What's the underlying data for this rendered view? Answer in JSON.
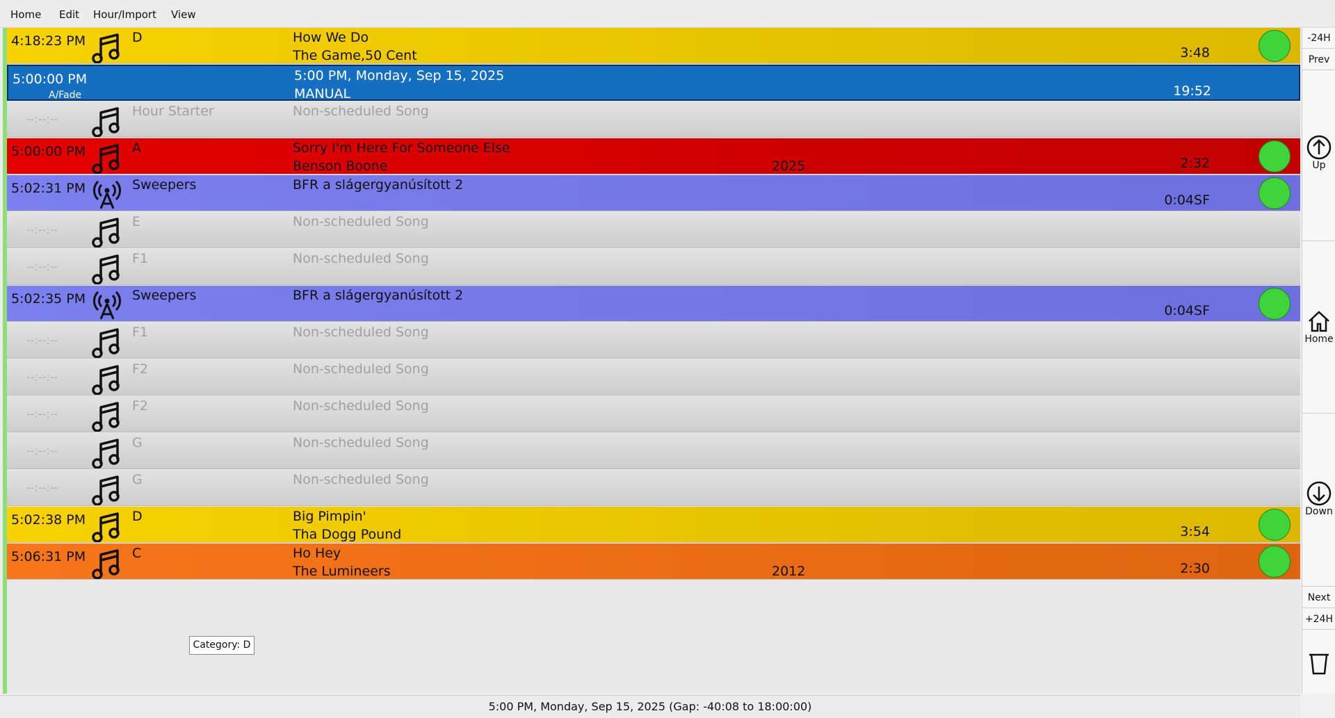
{
  "menu": {
    "home": "Home",
    "edit": "Edit",
    "hour_import": "Hour/Import",
    "view": "View"
  },
  "rows": [
    {
      "color": "yellow",
      "time": "4:18:23 PM",
      "icon": "music-note-icon",
      "cat": "D",
      "title": "How We Do",
      "artist": "The Game,50 Cent",
      "year": "",
      "dur": "3:48",
      "led": true
    },
    {
      "color": "blue",
      "time": "5:00:00 PM",
      "sub": "A/Fade",
      "icon": "",
      "cat": "",
      "title": "5:00 PM, Monday, Sep 15, 2025",
      "artist": "MANUAL",
      "year": "",
      "dur": "19:52",
      "led": false
    },
    {
      "color": "grey",
      "time": "--:--:--",
      "icon": "music-note-icon",
      "cat": "Hour Starter",
      "title": "Non-scheduled Song",
      "artist": "",
      "year": "",
      "dur": "",
      "led": false
    },
    {
      "color": "red",
      "time": "5:00:00 PM",
      "icon": "music-note-icon",
      "cat": "A",
      "title": "Sorry I'm Here For Someone Else",
      "artist": "Benson Boone",
      "year": "2025",
      "dur": "2:32",
      "led": true
    },
    {
      "color": "purple",
      "time": "5:02:31 PM",
      "icon": "antenna-icon",
      "cat": "Sweepers",
      "title": "BFR a slágergyanúsított 2",
      "artist": "",
      "year": "",
      "dur": "0:04SF",
      "led": true
    },
    {
      "color": "grey",
      "time": "--:--:--",
      "icon": "music-note-icon",
      "cat": "E",
      "title": "Non-scheduled Song",
      "artist": "",
      "year": "",
      "dur": "",
      "led": false
    },
    {
      "color": "grey",
      "time": "--:--:--",
      "icon": "music-note-icon",
      "cat": "F1",
      "title": "Non-scheduled Song",
      "artist": "",
      "year": "",
      "dur": "",
      "led": false
    },
    {
      "color": "purple",
      "time": "5:02:35 PM",
      "icon": "antenna-icon",
      "cat": "Sweepers",
      "title": "BFR a slágergyanúsított 2",
      "artist": "",
      "year": "",
      "dur": "0:04SF",
      "led": true
    },
    {
      "color": "grey",
      "time": "--:--:--",
      "icon": "music-note-icon",
      "cat": "F1",
      "title": "Non-scheduled Song",
      "artist": "",
      "year": "",
      "dur": "",
      "led": false
    },
    {
      "color": "grey",
      "time": "--:--:--",
      "icon": "music-note-icon",
      "cat": "F2",
      "title": "Non-scheduled Song",
      "artist": "",
      "year": "",
      "dur": "",
      "led": false
    },
    {
      "color": "grey",
      "time": "--:--:--",
      "icon": "music-note-icon",
      "cat": "F2",
      "title": "Non-scheduled Song",
      "artist": "",
      "year": "",
      "dur": "",
      "led": false
    },
    {
      "color": "grey",
      "time": "--:--:--",
      "icon": "music-note-icon",
      "cat": "G",
      "title": "Non-scheduled Song",
      "artist": "",
      "year": "",
      "dur": "",
      "led": false
    },
    {
      "color": "grey",
      "time": "--:--:--",
      "icon": "music-note-icon",
      "cat": "G",
      "title": "Non-scheduled Song",
      "artist": "",
      "year": "",
      "dur": "",
      "led": false
    },
    {
      "color": "yellow",
      "time": "5:02:38 PM",
      "icon": "music-note-icon",
      "cat": "D",
      "title": "Big Pimpin'",
      "artist": "Tha Dogg Pound",
      "year": "",
      "dur": "3:54",
      "led": true
    },
    {
      "color": "orange",
      "time": "5:06:31 PM",
      "icon": "music-note-icon",
      "cat": "C",
      "title": "Ho Hey",
      "artist": "The Lumineers",
      "year": "2012",
      "dur": "2:30",
      "led": true
    }
  ],
  "tooltip": "Category: D",
  "sidebar": {
    "minus24": "-24H",
    "prev": "Prev",
    "up": "Up",
    "home": "Home",
    "down": "Down",
    "next": "Next",
    "plus24": "+24H"
  },
  "status": "5:00 PM, Monday, Sep 15, 2025 (Gap: -40:08 to 18:00:00)"
}
